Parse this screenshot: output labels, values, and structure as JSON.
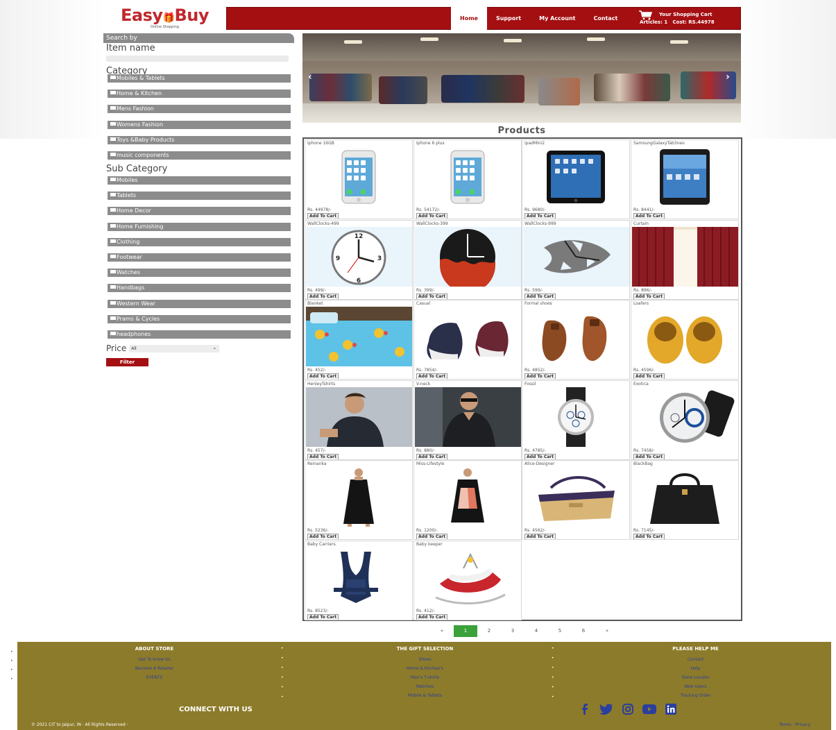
{
  "brand": {
    "name": "Easy Buy",
    "name_left": "Easy",
    "name_right": "Buy",
    "tagline": "Online Shopping"
  },
  "nav": [
    {
      "label": "Home",
      "active": true
    },
    {
      "label": "Support",
      "active": false
    },
    {
      "label": "My Account",
      "active": false
    },
    {
      "label": "Contact",
      "active": false
    }
  ],
  "cart": {
    "title": "Your Shopping Cart",
    "articles_label": "Articles:",
    "articles": "1",
    "cost_label": "Cost:",
    "cost": "RS.44978"
  },
  "sidebar": {
    "search_by": "Search by",
    "item_name_label": "Item name",
    "category_heading": "Category",
    "categories": [
      "Mobiles & Tablets",
      "Home & Kitchen",
      "Mens Fashion",
      "Womens Fashion",
      "Toys &Baby Products",
      "music components"
    ],
    "subcategory_heading": "Sub Category",
    "subcategories": [
      "Mobiles",
      "Tablets",
      "Home Decor",
      "Home Furnishing",
      "Clothing",
      "Footwear",
      "Watches",
      "Handbags",
      "Western Wear",
      "Prams & Cycles",
      "headphones"
    ],
    "price_label": "Price",
    "price_selected": "All",
    "filter_label": "Filter"
  },
  "products_title": "Products",
  "add_to_cart_label": "Add To Cart",
  "products": [
    {
      "name": "Iphone 16GB",
      "price": "Rs. 44978/-",
      "kind": "phone"
    },
    {
      "name": "Iphone 6 plus",
      "price": "Rs. 54172/-",
      "kind": "phone"
    },
    {
      "name": "ipadMini2",
      "price": "Rs. 9680/-",
      "kind": "ipad"
    },
    {
      "name": "SamsungGalaxyTab3neo",
      "price": "Rs. 8441/-",
      "kind": "tablet"
    },
    {
      "name": "WallClocks-499",
      "price": "Rs. 499/-",
      "kind": "clock-white"
    },
    {
      "name": "WallClocks-399",
      "price": "Rs. 399/-",
      "kind": "clock-black"
    },
    {
      "name": "WallClocks-999",
      "price": "Rs. 599/-",
      "kind": "clock-art"
    },
    {
      "name": "Curtain",
      "price": "Rs. 896/-",
      "kind": "curtain"
    },
    {
      "name": "Blanket",
      "price": "Rs. 452/-",
      "kind": "blanket"
    },
    {
      "name": "Casual",
      "price": "Rs. 7854/-",
      "kind": "sneaker"
    },
    {
      "name": "Formal shoes",
      "price": "Rs. 4852/-",
      "kind": "formal-shoe"
    },
    {
      "name": "Loafers",
      "price": "Rs. 4596/-",
      "kind": "loafer"
    },
    {
      "name": "HenleyTshirts",
      "price": "Rs. 457/-",
      "kind": "man1"
    },
    {
      "name": "V-neck",
      "price": "Rs. 880/-",
      "kind": "man2"
    },
    {
      "name": "Fossil",
      "price": "Rs. 4785/-",
      "kind": "watch1"
    },
    {
      "name": "Exotica",
      "price": "Rs. 7458/-",
      "kind": "watch2"
    },
    {
      "name": "Reinanka",
      "price": "Rs. 5236/-",
      "kind": "dress-black"
    },
    {
      "name": "Miss-Lifestyle",
      "price": "Rs. 1200/-",
      "kind": "dress-color"
    },
    {
      "name": "Alice-Designer",
      "price": "Rs. 4562/-",
      "kind": "bag-tan"
    },
    {
      "name": "BlackBag",
      "price": "Rs. 7145/-",
      "kind": "bag-black"
    },
    {
      "name": "Baby Carriers",
      "price": "Rs. 8523/-",
      "kind": "carrier"
    },
    {
      "name": "Baby keeper",
      "price": "Rs. 412/-",
      "kind": "rocker"
    }
  ],
  "pagination": {
    "prev": "«",
    "next": "»",
    "pages": [
      "1",
      "2",
      "3",
      "4",
      "5",
      "6"
    ],
    "active": "1"
  },
  "footer": {
    "columns": [
      {
        "heading": "ABOUT STORE",
        "links": [
          "Get To know Us",
          "Become A Retailer",
          "EVENTS"
        ]
      },
      {
        "heading": "THE GIFT SELECTION",
        "links": [
          "Shoes",
          "Home & Kitchen's",
          "Men's T-shirts",
          "Watches",
          "Mobile & Tablets"
        ]
      },
      {
        "heading": "PLEASE HELP ME",
        "links": [
          "Contact",
          "Help",
          "Store Locator",
          "New Users",
          "Tracking Order"
        ]
      }
    ],
    "connect": "CONNECT WITH US",
    "copyright": "© 2021 CIT to Jaipur, IN · All Rights Reserved ·",
    "terms": "Terms",
    "privacy": "Privacy",
    "social_icons": [
      "facebook-icon",
      "twitter-icon",
      "instagram-icon",
      "youtube-icon",
      "linkedin-icon"
    ]
  },
  "colors": {
    "brand_red": "#a40f12",
    "footer_olive": "#8c7b2a",
    "sidebar_gray": "#8c8c8c",
    "pager_green": "#3aa23a",
    "link_blue": "#2b3f9e"
  }
}
